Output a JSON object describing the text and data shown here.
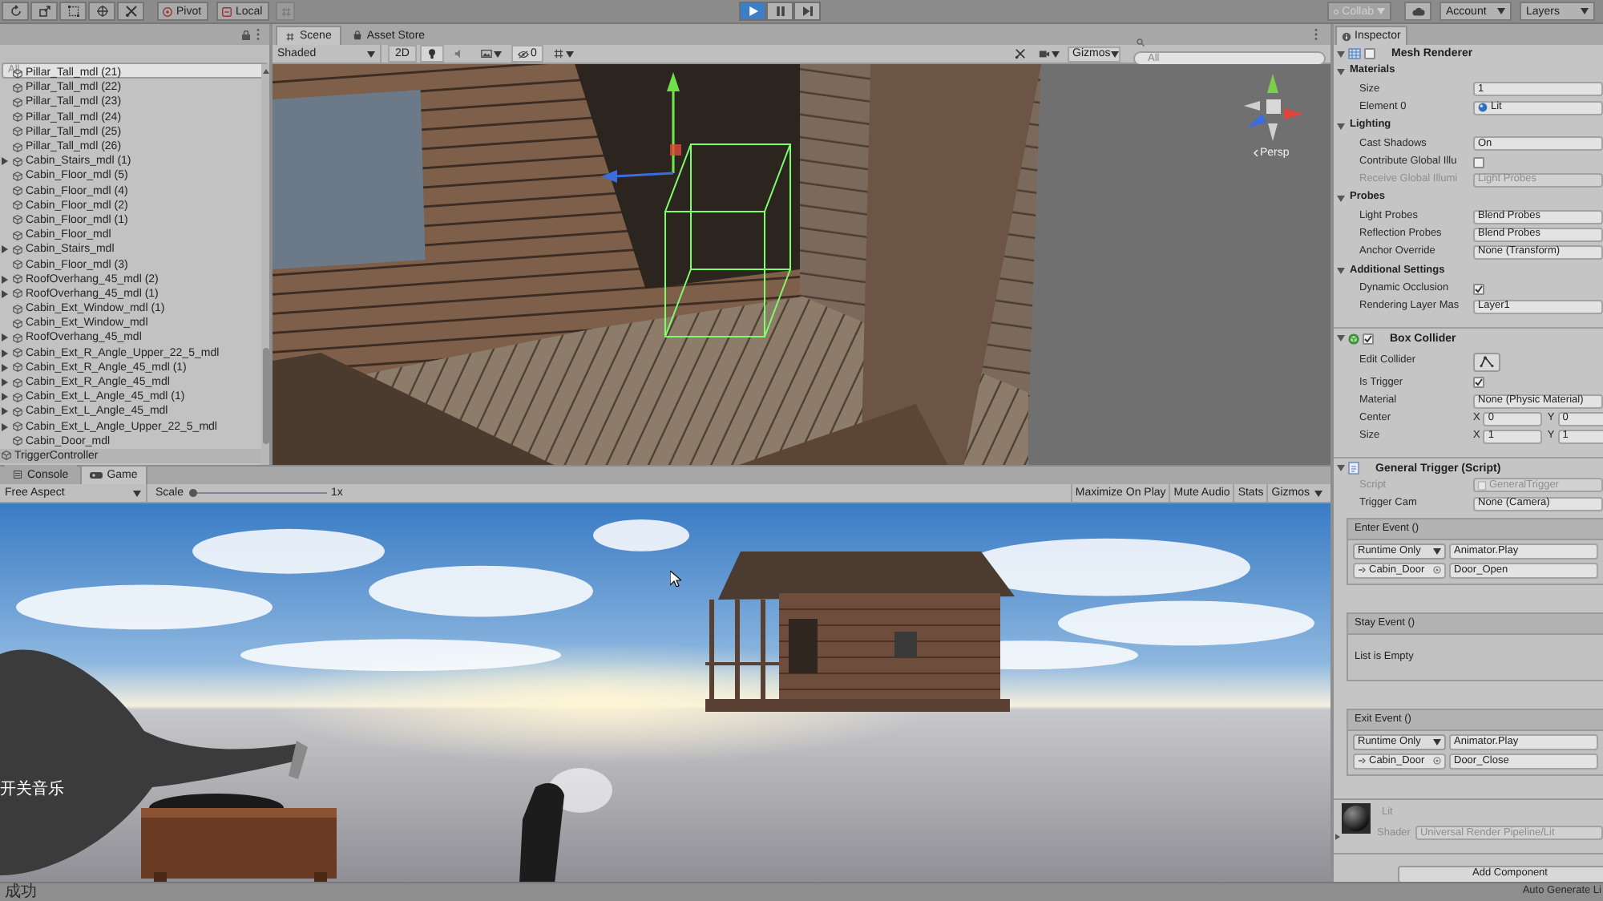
{
  "toolbar": {
    "pivot": "Pivot",
    "local": "Local",
    "playback": [
      {
        "kind": "play",
        "selected": true
      },
      {
        "kind": "pause",
        "selected": false
      },
      {
        "kind": "step",
        "selected": false
      }
    ],
    "collab": {
      "label": "Collab",
      "disabled": true
    },
    "account": "Account",
    "layers": "Layers"
  },
  "hierarchy": {
    "search": {
      "placeholder": "All"
    },
    "items": [
      {
        "children": [
          {
            "label": "Pillar_Tall_mdl (21)",
            "expandable": false
          },
          {
            "label": "Pillar_Tall_mdl (22)",
            "expandable": false
          },
          {
            "label": "Pillar_Tall_mdl (23)",
            "expandable": false
          },
          {
            "label": "Pillar_Tall_mdl (24)",
            "expandable": false
          },
          {
            "label": "Pillar_Tall_mdl (25)",
            "expandable": false
          },
          {
            "label": "Pillar_Tall_mdl (26)",
            "expandable": false
          },
          {
            "label": "Cabin_Stairs_mdl (1)",
            "expandable": true
          },
          {
            "label": "Cabin_Floor_mdl (5)",
            "expandable": false
          },
          {
            "label": "Cabin_Floor_mdl (4)",
            "expandable": false
          },
          {
            "label": "Cabin_Floor_mdl (2)",
            "expandable": false
          },
          {
            "label": "Cabin_Floor_mdl (1)",
            "expandable": false
          },
          {
            "label": "Cabin_Floor_mdl",
            "expandable": false
          },
          {
            "label": "Cabin_Stairs_mdl",
            "expandable": true
          },
          {
            "label": "Cabin_Floor_mdl (3)",
            "expandable": false
          },
          {
            "label": "RoofOverhang_45_mdl (2)",
            "expandable": true
          },
          {
            "label": "RoofOverhang_45_mdl (1)",
            "expandable": true
          },
          {
            "label": "Cabin_Ext_Window_mdl (1)",
            "expandable": false
          },
          {
            "label": "Cabin_Ext_Window_mdl",
            "expandable": false
          },
          {
            "label": "RoofOverhang_45_mdl",
            "expandable": true
          },
          {
            "label": "Cabin_Ext_R_Angle_Upper_22_5_mdl",
            "expandable": true
          },
          {
            "label": "Cabin_Ext_R_Angle_45_mdl (1)",
            "expandable": true
          },
          {
            "label": "Cabin_Ext_R_Angle_45_mdl",
            "expandable": true
          },
          {
            "label": "Cabin_Ext_L_Angle_45_mdl (1)",
            "expandable": true
          },
          {
            "label": "Cabin_Ext_L_Angle_45_mdl",
            "expandable": true
          },
          {
            "label": "Cabin_Ext_L_Angle_Upper_22_5_mdl",
            "expandable": true
          },
          {
            "label": "Cabin_Door_mdl",
            "expandable": false
          }
        ]
      },
      {
        "label": "TriggerController",
        "expandable": false
      }
    ]
  },
  "scene": {
    "tabs": [
      {
        "label": "Scene",
        "selected": true
      },
      {
        "label": "Asset Store",
        "selected": false
      }
    ],
    "shading": "Shaded",
    "mode_2d": "2D",
    "view_toggles": [
      {
        "kind": "lighting",
        "on": true
      },
      {
        "kind": "audio",
        "on": false
      },
      {
        "kind": "effects",
        "on": false
      },
      {
        "kind": "hidden_objects",
        "on": true,
        "count": "0"
      },
      {
        "kind": "overlay",
        "on": false
      }
    ],
    "gizmos": "Gizmos",
    "search": {
      "placeholder": "All"
    },
    "projection": "Persp"
  },
  "game": {
    "tabs": [
      {
        "label": "Console",
        "selected": false
      },
      {
        "label": "Game",
        "selected": true
      }
    ],
    "aspect": "Free Aspect",
    "scale": {
      "label": "Scale",
      "level": 0,
      "reading": "1x"
    },
    "buttons": [
      "Maximize On Play",
      "Mute Audio",
      "Stats"
    ],
    "gizmos": "Gizmos",
    "overlay_button": "开关音乐"
  },
  "inspector": {
    "title": "Inspector",
    "components": [
      {
        "kind": "mesh_renderer",
        "title": "Mesh Renderer",
        "enabled": false,
        "rows": [
          {
            "kind": "foldout",
            "label": "Materials",
            "expanded": true
          },
          {
            "kind": "field",
            "label": "Size",
            "value": "1",
            "disabled": false
          },
          {
            "kind": "material",
            "label": "Element 0",
            "value": "Lit"
          },
          {
            "kind": "foldout",
            "label": "Lighting",
            "expanded": true
          },
          {
            "kind": "field",
            "label": "Cast Shadows",
            "value": "On",
            "disabled": false
          },
          {
            "kind": "check",
            "label": "Contribute Global Illu",
            "checked": false
          },
          {
            "kind": "field",
            "label": "Receive Global Illumi",
            "value": "Light Probes",
            "disabled": true
          },
          {
            "kind": "foldout",
            "label": "Probes",
            "expanded": true
          },
          {
            "kind": "field",
            "label": "Light Probes",
            "value": "Blend Probes",
            "disabled": false
          },
          {
            "kind": "field",
            "label": "Reflection Probes",
            "value": "Blend Probes",
            "disabled": false
          },
          {
            "kind": "field",
            "label": "Anchor Override",
            "value": "None (Transform)",
            "disabled": false
          },
          {
            "kind": "foldout",
            "label": "Additional Settings",
            "expanded": true
          },
          {
            "kind": "check",
            "label": "Dynamic Occlusion",
            "checked": true
          },
          {
            "kind": "field",
            "label": "Rendering Layer Mas",
            "value": "Layer1",
            "disabled": false
          }
        ]
      },
      {
        "kind": "box_collider",
        "title": "Box Collider",
        "enabled": true,
        "rows": [
          {
            "kind": "edit",
            "label": "Edit Collider"
          },
          {
            "kind": "check",
            "label": "Is Trigger",
            "checked": true
          },
          {
            "kind": "field",
            "label": "Material",
            "value": "None (Physic Material)",
            "disabled": false
          },
          {
            "kind": "vector",
            "label": "Center",
            "axes": [
              {
                "axis": "X",
                "value": "0"
              },
              {
                "axis": "Y",
                "value": "0"
              }
            ]
          },
          {
            "kind": "vector",
            "label": "Size",
            "axes": [
              {
                "axis": "X",
                "value": "1"
              },
              {
                "axis": "Y",
                "value": "1"
              }
            ]
          }
        ]
      },
      {
        "kind": "script",
        "title": "General Trigger (Script)",
        "rows": [
          {
            "kind": "script",
            "label": "Script",
            "value": "GeneralTrigger"
          },
          {
            "kind": "field",
            "label": "Trigger Cam",
            "value": "None (Camera)",
            "disabled": false
          },
          {
            "kind": "event",
            "title": "Enter Event ()",
            "listeners": [
              {
                "mode": "Runtime Only",
                "function": "Animator.Play",
                "target": "Cabin_Door",
                "argument": "Door_Open"
              }
            ]
          },
          {
            "kind": "event",
            "title": "Stay Event ()",
            "empty_text": "List is Empty"
          },
          {
            "kind": "event",
            "title": "Exit Event ()",
            "listeners": [
              {
                "mode": "Runtime Only",
                "function": "Animator.Play",
                "target": "Cabin_Door",
                "argument": "Door_Close"
              }
            ]
          }
        ]
      }
    ],
    "material": {
      "name": "Lit",
      "shader_label": "Shader",
      "shader": "Universal Render Pipeline/Lit"
    },
    "add_component": "Add Component"
  },
  "status_bar": {
    "message": "成功",
    "right": "Auto Generate Li"
  }
}
